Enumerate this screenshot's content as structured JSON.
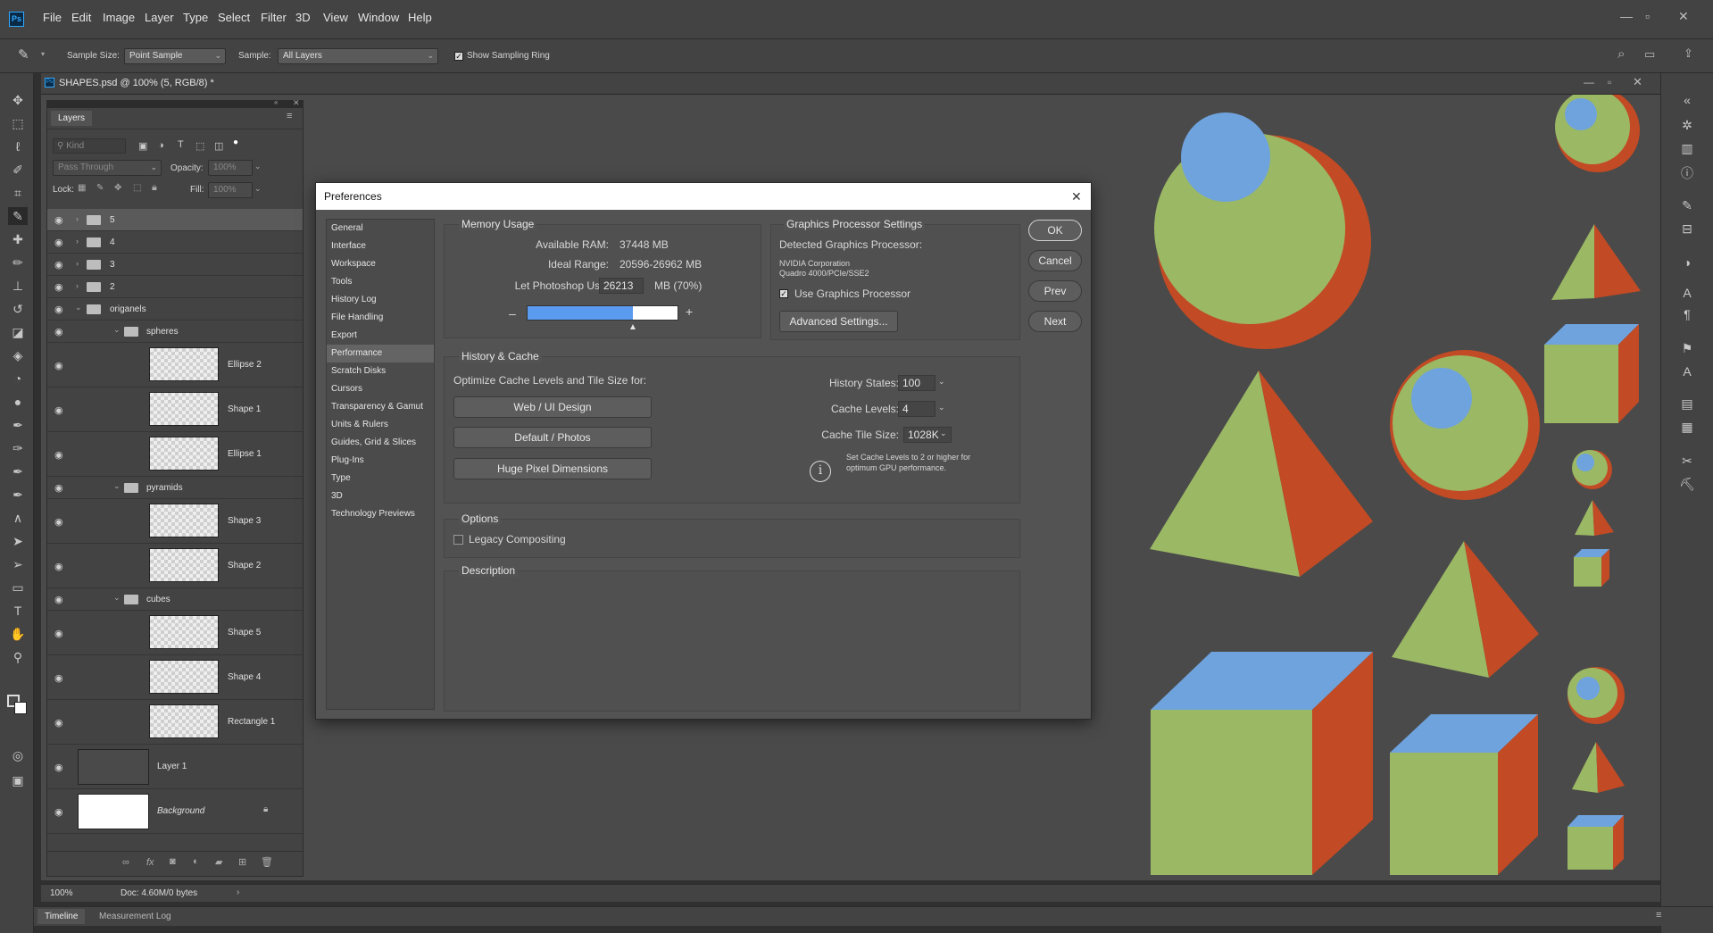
{
  "app": {
    "logo": "Ps",
    "menu": [
      "File",
      "Edit",
      "Image",
      "Layer",
      "Type",
      "Select",
      "Filter",
      "3D",
      "View",
      "Window",
      "Help"
    ]
  },
  "options_bar": {
    "sample_size_label": "Sample Size:",
    "sample_size_value": "Point Sample",
    "sample_label": "Sample:",
    "sample_value": "All Layers",
    "show_ring_label": "Show Sampling Ring",
    "show_ring_checked": true
  },
  "document": {
    "tab_title": "SHAPES.psd @ 100% (5, RGB/8) *"
  },
  "layers_panel": {
    "title": "Layers",
    "kind_placeholder": "Kind",
    "blend_mode": "Pass Through",
    "opacity_label": "Opacity:",
    "opacity_value": "100%",
    "lock_label": "Lock:",
    "fill_label": "Fill:",
    "fill_value": "100%",
    "layers": [
      {
        "name": "5",
        "type": "group"
      },
      {
        "name": "4",
        "type": "group"
      },
      {
        "name": "3",
        "type": "group"
      },
      {
        "name": "2",
        "type": "group"
      },
      {
        "name": "origanels",
        "type": "group-open"
      },
      {
        "name": "spheres",
        "type": "subgroup"
      },
      {
        "name": "Ellipse 2",
        "type": "layer"
      },
      {
        "name": "Shape 1",
        "type": "layer"
      },
      {
        "name": "Ellipse 1",
        "type": "layer"
      },
      {
        "name": "pyramids",
        "type": "subgroup"
      },
      {
        "name": "Shape 3",
        "type": "layer"
      },
      {
        "name": "Shape 2",
        "type": "layer"
      },
      {
        "name": "cubes",
        "type": "subgroup"
      },
      {
        "name": "Shape 5",
        "type": "layer"
      },
      {
        "name": "Shape 4",
        "type": "layer"
      },
      {
        "name": "Rectangle 1",
        "type": "layer"
      },
      {
        "name": "Layer 1",
        "type": "layer-gray"
      },
      {
        "name": "Background",
        "type": "background"
      }
    ]
  },
  "status": {
    "zoom": "100%",
    "doc": "Doc: 4.60M/0 bytes"
  },
  "bottom_tabs": [
    "Timeline",
    "Measurement Log"
  ],
  "preferences": {
    "title": "Preferences",
    "nav": [
      "General",
      "Interface",
      "Workspace",
      "Tools",
      "History Log",
      "File Handling",
      "Export",
      "Performance",
      "Scratch Disks",
      "Cursors",
      "Transparency & Gamut",
      "Units & Rulers",
      "Guides, Grid & Slices",
      "Plug-Ins",
      "Type",
      "3D",
      "Technology Previews"
    ],
    "selected_nav": "Performance",
    "memory": {
      "title": "Memory Usage",
      "available_label": "Available RAM:",
      "available_value": "37448 MB",
      "ideal_label": "Ideal Range:",
      "ideal_value": "20596-26962 MB",
      "let_label": "Let Photoshop Use:",
      "let_value": "26213",
      "let_unit": "MB (70%)",
      "slider_fraction": 0.7,
      "minus": "–",
      "plus": "+"
    },
    "gpu": {
      "title": "Graphics Processor Settings",
      "detected_label": "Detected Graphics Processor:",
      "gpu_line1": "NVIDIA Corporation",
      "gpu_line2": "Quadro 4000/PCIe/SSE2",
      "use_gpu_label": "Use Graphics Processor",
      "use_gpu_checked": true,
      "advanced_button": "Advanced Settings..."
    },
    "buttons": {
      "ok": "OK",
      "cancel": "Cancel",
      "prev": "Prev",
      "next": "Next"
    },
    "history_cache": {
      "title": "History & Cache",
      "optimize_label": "Optimize Cache Levels and Tile Size for:",
      "btn_web": "Web / UI Design",
      "btn_default": "Default / Photos",
      "btn_huge": "Huge Pixel Dimensions",
      "history_states_label": "History States:",
      "history_states_value": "100",
      "cache_levels_label": "Cache Levels:",
      "cache_levels_value": "4",
      "tile_size_label": "Cache Tile Size:",
      "tile_size_value": "1028K",
      "info_line1": "Set Cache Levels to 2 or higher for",
      "info_line2": "optimum GPU performance."
    },
    "options": {
      "title": "Options",
      "legacy_label": "Legacy Compositing",
      "legacy_checked": false
    },
    "description": {
      "title": "Description"
    }
  },
  "colors": {
    "green": "#9bb865",
    "red": "#c24a24",
    "blue": "#6fa3dd",
    "canvas": "#4a4a4a",
    "slider_fill": "#5a9bf0"
  }
}
